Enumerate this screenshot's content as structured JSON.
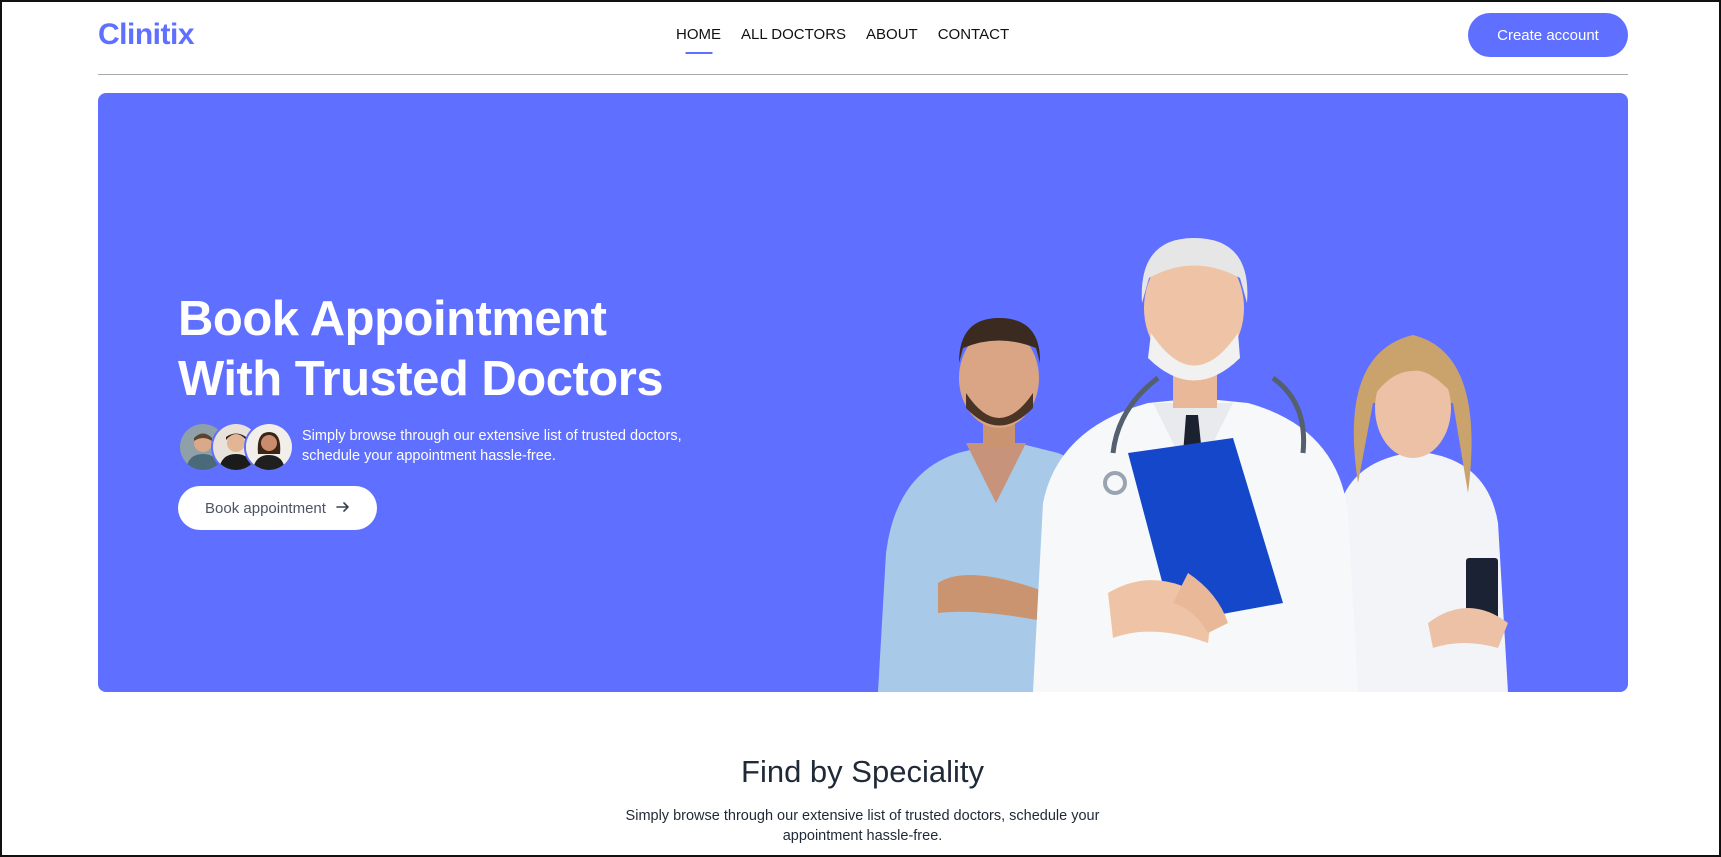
{
  "brand": {
    "logo": "Clinitix",
    "accent_color": "#5f6fff"
  },
  "nav": {
    "items": [
      {
        "label": "HOME",
        "active": true
      },
      {
        "label": "ALL DOCTORS",
        "active": false
      },
      {
        "label": "ABOUT",
        "active": false
      },
      {
        "label": "CONTACT",
        "active": false
      }
    ],
    "create_account_label": "Create account"
  },
  "hero": {
    "title_line1": "Book Appointment",
    "title_line2": "With Trusted Doctors",
    "desc_line1": "Simply browse through our extensive list of trusted doctors,",
    "desc_line2": "schedule your appointment hassle-free.",
    "book_button_label": "Book appointment",
    "book_button_icon": "arrow-right-icon",
    "image_alt": "doctors-group-image"
  },
  "speciality": {
    "title": "Find by Speciality",
    "desc_line1": "Simply browse through our extensive list of trusted doctors, schedule your",
    "desc_line2": "appointment hassle-free."
  }
}
